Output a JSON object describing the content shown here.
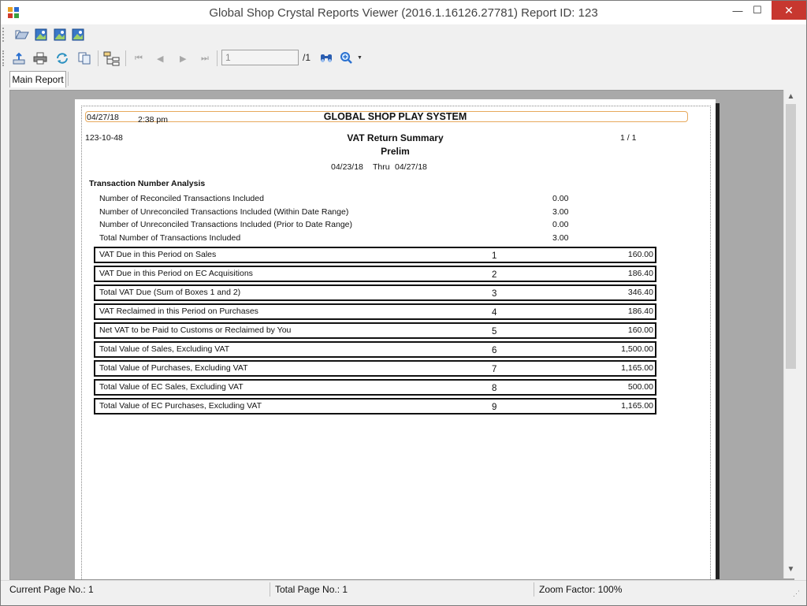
{
  "window": {
    "title": "Global Shop Crystal Reports Viewer (2016.1.16126.27781) Report ID: 123",
    "min_glyph": "—",
    "max_glyph": "☐",
    "close_glyph": "✕"
  },
  "toolbar": {
    "page_input_value": "1",
    "page_total": "/1"
  },
  "tabs": [
    {
      "label": "Main Report"
    }
  ],
  "report": {
    "print_date": "04/27/18",
    "print_time": "2:38 pm",
    "company": "GLOBAL SHOP PLAY SYSTEM",
    "report_code": "123-10-48",
    "title": "VAT Return Summary",
    "subtitle": "Prelim",
    "page_of": "1  /  1",
    "date_from": "04/23/18",
    "thru_label": "Thru",
    "date_to": "04/27/18",
    "section_heading": "Transaction Number Analysis",
    "analysis": [
      {
        "label": "Number of Reconciled Transactions Included",
        "value": "0.00"
      },
      {
        "label": "Number of Unreconciled Transactions Included (Within Date Range)",
        "value": "3.00"
      },
      {
        "label": "Number of Unreconciled Transactions Included (Prior to Date Range)",
        "value": "0.00"
      },
      {
        "label": "Total Number of Transactions Included",
        "value": "3.00"
      }
    ],
    "boxes": [
      {
        "label": "VAT Due in this Period on Sales",
        "number": "1",
        "amount": "160.00"
      },
      {
        "label": "VAT Due in this Period on EC Acquisitions",
        "number": "2",
        "amount": "186.40"
      },
      {
        "label": "Total VAT Due (Sum of Boxes 1 and 2)",
        "number": "3",
        "amount": "346.40"
      },
      {
        "label": "VAT Reclaimed in this Period on Purchases",
        "number": "4",
        "amount": "186.40"
      },
      {
        "label": "Net VAT to be Paid to Customs or Reclaimed by You",
        "number": "5",
        "amount": "160.00"
      },
      {
        "label": "Total Value of Sales, Excluding VAT",
        "number": "6",
        "amount": "1,500.00"
      },
      {
        "label": "Total Value of Purchases, Excluding VAT",
        "number": "7",
        "amount": "1,165.00"
      },
      {
        "label": "Total Value of EC Sales, Excluding VAT",
        "number": "8",
        "amount": "500.00"
      },
      {
        "label": "Total Value of EC Purchases, Excluding VAT",
        "number": "9",
        "amount": "1,165.00"
      }
    ]
  },
  "status": {
    "current_page": "Current Page No.: 1",
    "total_page": "Total Page No.: 1",
    "zoom": "Zoom Factor: 100%"
  }
}
